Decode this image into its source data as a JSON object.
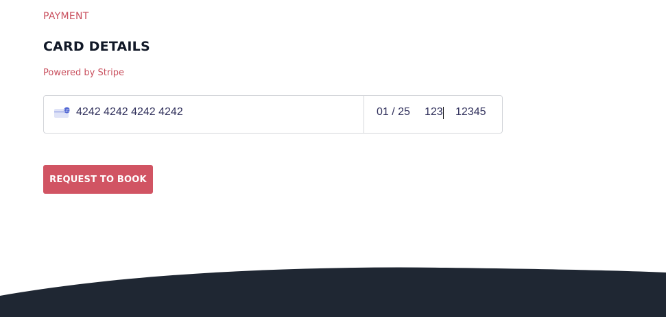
{
  "section": {
    "label": "PAYMENT"
  },
  "card": {
    "title": "CARD DETAILS",
    "powered_by": "Powered by Stripe",
    "number": "4242 4242 4242 4242",
    "expiry": "01 / 25",
    "cvc": "123",
    "zip": "12345",
    "icon": "credit-card-icon"
  },
  "actions": {
    "book_label": "REQUEST TO BOOK"
  },
  "colors": {
    "accent": "#d15463",
    "text_dark": "#111827",
    "footer": "#1f2733",
    "input_text": "#32325d"
  }
}
